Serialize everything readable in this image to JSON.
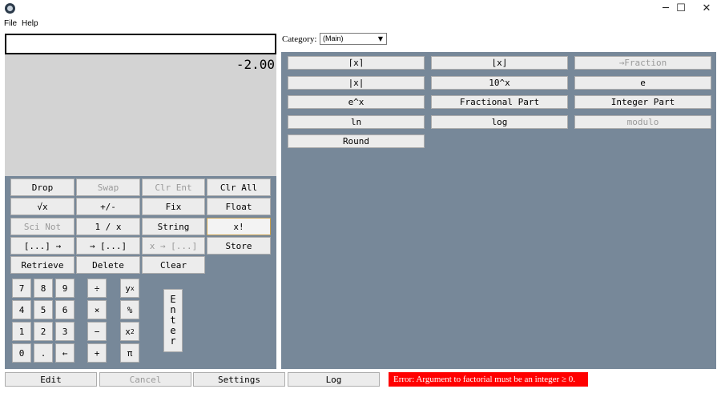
{
  "menu": {
    "file": "File",
    "help": "Help"
  },
  "window_controls": {
    "minimize": "─",
    "maximize": "☐",
    "close": "✕"
  },
  "entry": {
    "value": ""
  },
  "stack": {
    "top_value": "-2.00"
  },
  "left_buttons": {
    "drop": "Drop",
    "swap": "Swap",
    "clr_ent": "Clr Ent",
    "clr_all": "Clr All",
    "sqrt": "√x",
    "negate": "+/-",
    "fix": "Fix",
    "float": "Float",
    "sci_not": "Sci Not",
    "reciprocal": "1 / x",
    "string": "String",
    "factorial": "x!",
    "unpack_list": "[...] →",
    "pack_list": "→ [...]",
    "x_to_list": "x → [...]",
    "store": "Store",
    "retrieve": "Retrieve",
    "delete": "Delete",
    "clear": "Clear"
  },
  "keypad": {
    "k7": "7",
    "k8": "8",
    "k9": "9",
    "divide": "÷",
    "power_base": "y",
    "power_exp": "x",
    "k4": "4",
    "k5": "5",
    "k6": "6",
    "multiply": "×",
    "percent": "%",
    "k1": "1",
    "k2": "2",
    "k3": "3",
    "minus": "−",
    "square_base": "x",
    "square_exp": "2",
    "k0": "0",
    "dot": ".",
    "backspace": "←",
    "plus": "+",
    "pi": "π",
    "enter_letters": [
      "E",
      "n",
      "t",
      "e",
      "r"
    ]
  },
  "category": {
    "label": "Category:",
    "selected": "(Main)"
  },
  "function_buttons": {
    "ceiling": "⌈x⌉",
    "floor": "⌊x⌋",
    "to_fraction": "→Fraction",
    "abs": "|x|",
    "ten_pow": "10^x",
    "e_const": "e",
    "exp": "e^x",
    "frac_part": "Fractional Part",
    "int_part": "Integer Part",
    "ln": "ln",
    "log": "log",
    "modulo": "modulo",
    "round": "Round"
  },
  "bottom_bar": {
    "edit": "Edit",
    "cancel": "Cancel",
    "settings": "Settings",
    "log": "Log"
  },
  "status": {
    "error": "Error: Argument to factorial must be an integer ≥ 0."
  }
}
